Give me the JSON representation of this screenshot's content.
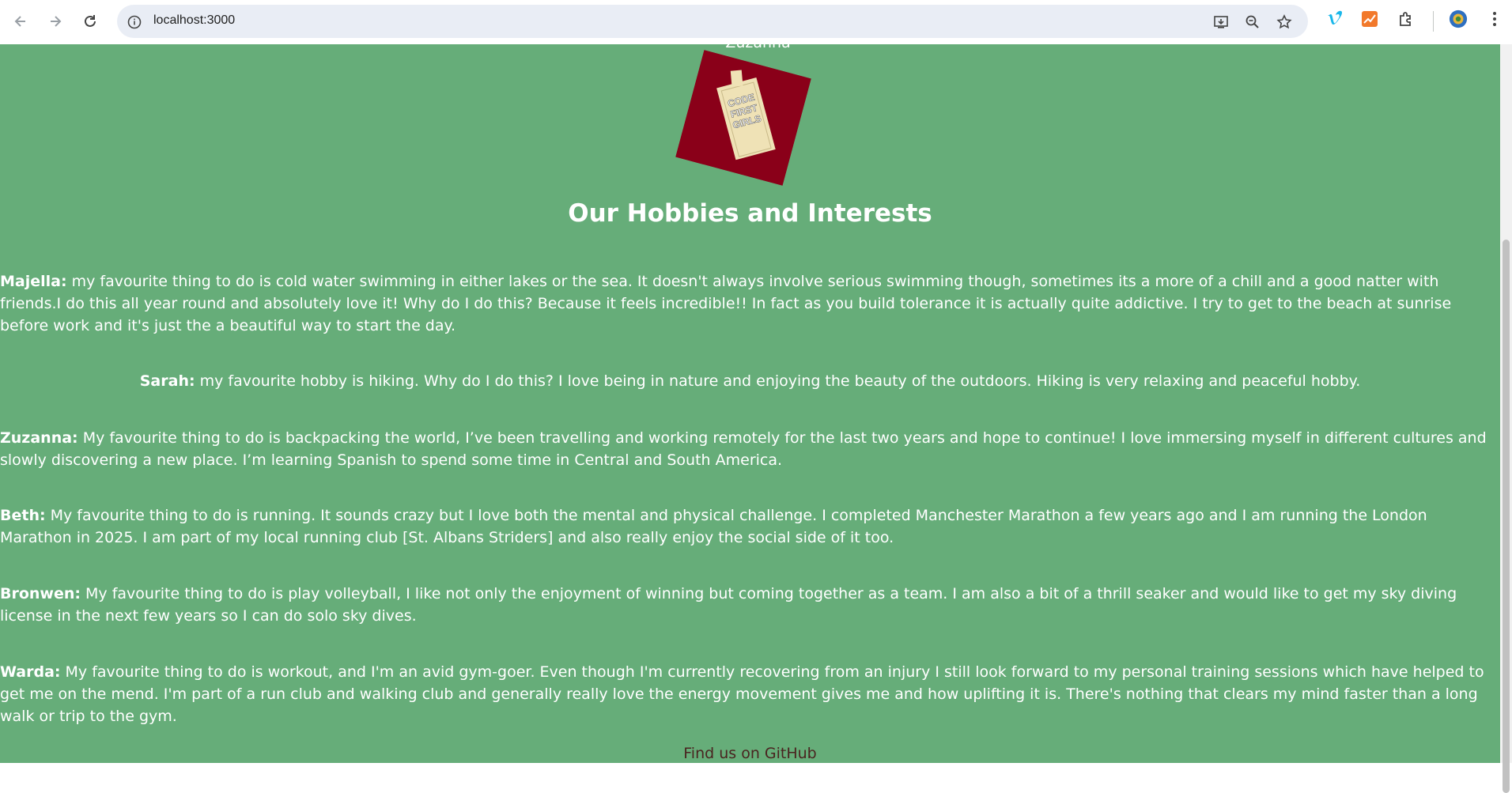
{
  "browser": {
    "url": "localhost:3000",
    "back_icon": "arrow-left-icon",
    "forward_icon": "arrow-right-icon",
    "reload_icon": "reload-icon"
  },
  "page": {
    "prev_list_item": "Zuzanna",
    "logo_text": "CODE FIRST GIRLS",
    "heading": "Our Hobbies and Interests",
    "hobbies": [
      {
        "name": "Majella:",
        "text": " my favourite thing to do is cold water swimming in either lakes or the sea. It doesn't always involve serious swimming though, sometimes its a more of a chill and a good natter with friends.I do this all year round and absolutely love it! Why do I do this? Because it feels incredible!! In fact as you build tolerance it is actually quite addictive. I try to get to the beach at sunrise before work and it's just the a beautiful way to start the day."
      },
      {
        "name": "Sarah:",
        "text": " my favourite hobby is hiking. Why do I do this? I love being in nature and enjoying the beauty of the outdoors. Hiking is very relaxing and peaceful hobby."
      },
      {
        "name": "Zuzanna:",
        "text": " My favourite thing to do is backpacking the world, I’ve been travelling and working remotely for the last two years and hope to continue! I love immersing myself in different cultures and slowly discovering a new place. I’m learning Spanish to spend some time in Central and South America."
      },
      {
        "name": "Beth:",
        "text": " My favourite thing to do is running. It sounds crazy but I love both the mental and physical challenge. I completed Manchester Marathon a few years ago and I am running the London Marathon in 2025. I am part of my local running club [St. Albans Striders] and also really enjoy the social side of it too."
      },
      {
        "name": "Bronwen:",
        "text": " My favourite thing to do is play volleyball, I like not only the enjoyment of winning but coming together as a team. I am also a bit of a thrill seaker and would like to get my sky diving license in the next few years so I can do solo sky dives."
      },
      {
        "name": "Warda:",
        "text": " My favourite thing to do is workout, and I'm an avid gym-goer. Even though I'm currently recovering from an injury I still look forward to my personal training sessions which have helped to get me on the mend. I'm part of a run club and walking club and generally really love the energy movement gives me and how uplifting it is. There's nothing that clears my mind faster than a long walk or trip to the gym."
      }
    ],
    "footer_link": "Find us on GitHub"
  },
  "colors": {
    "page_bg": "#66ad79",
    "logo_bg": "#8a0019",
    "book": "#efe2b6"
  }
}
